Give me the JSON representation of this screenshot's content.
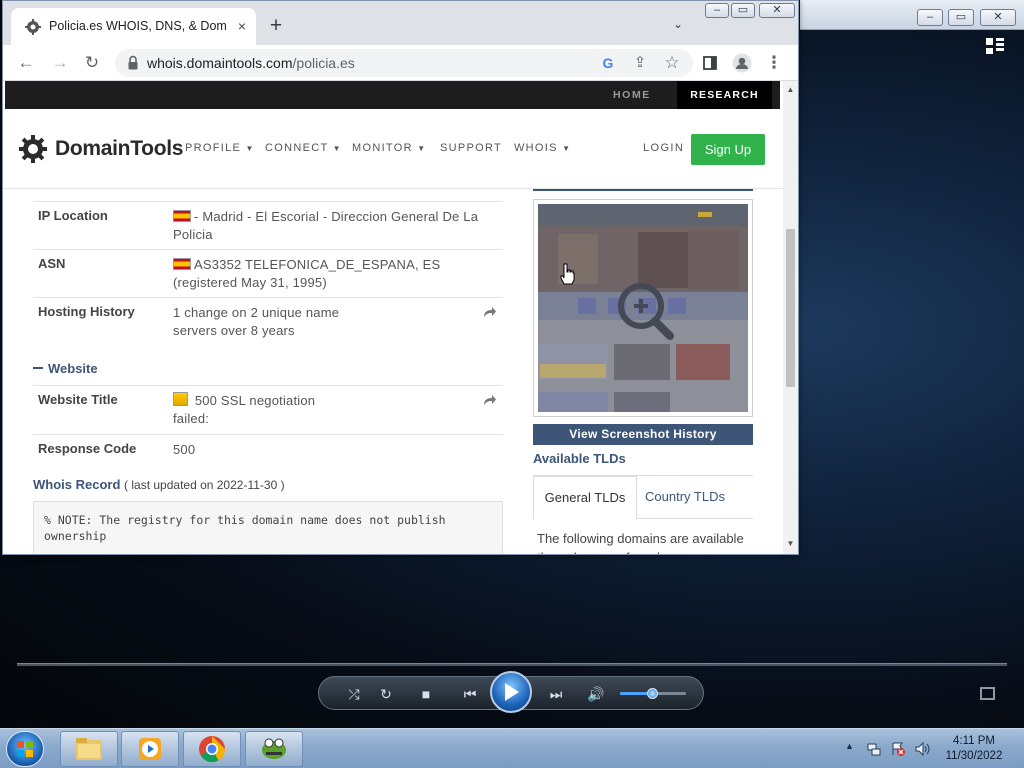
{
  "browser": {
    "tab_title": "Policia.es WHOIS, DNS, & Domain Info - DomainTools",
    "new_tab_symbol": "+",
    "close_tab_symbol": "×",
    "url_domain": "whois.domaintools.com",
    "url_path": "/policia.es"
  },
  "site": {
    "topbar": {
      "home": "HOME",
      "research": "RESEARCH"
    },
    "brand": "DomainTools",
    "nav": {
      "profile": "PROFILE",
      "connect": "CONNECT",
      "monitor": "MONITOR",
      "support": "SUPPORT",
      "whois": "WHOIS",
      "login": "LOGIN",
      "signup": "Sign Up"
    }
  },
  "profile": {
    "rows": [
      {
        "label": "IP Location",
        "value": "- Madrid - El Escorial - Direccion General De La Policia"
      },
      {
        "label": "ASN",
        "value": "AS3352 TELEFONICA_DE_ESPANA, ES (registered May 31, 1995)"
      },
      {
        "label": "Hosting History",
        "value": "1 change on 2 unique name servers over 8 years"
      }
    ],
    "website_section": "Website",
    "website_rows": [
      {
        "label": "Website Title",
        "value": "500 SSL negotiation failed:"
      },
      {
        "label": "Response Code",
        "value": "500"
      }
    ],
    "whois_heading": "Whois Record",
    "whois_updated": "( last updated on 2022-11-30 )",
    "whois_text": "% NOTE: The registry for this domain name does not publish ownership"
  },
  "sidebar": {
    "view_history": "View Screenshot History",
    "available_tlds": "Available TLDs",
    "tab_general": "General TLDs",
    "tab_country": "Country TLDs",
    "tld_description": "The following domains are available through our preferred"
  },
  "taskbar": {
    "time": "4:11 PM",
    "date": "11/30/2022"
  },
  "media_player": {
    "volume_fraction": 0.5
  },
  "colors": {
    "signup_green": "#2fb34a",
    "navy_accent": "#3d5678",
    "topbar_black": "#1d1d1d"
  }
}
